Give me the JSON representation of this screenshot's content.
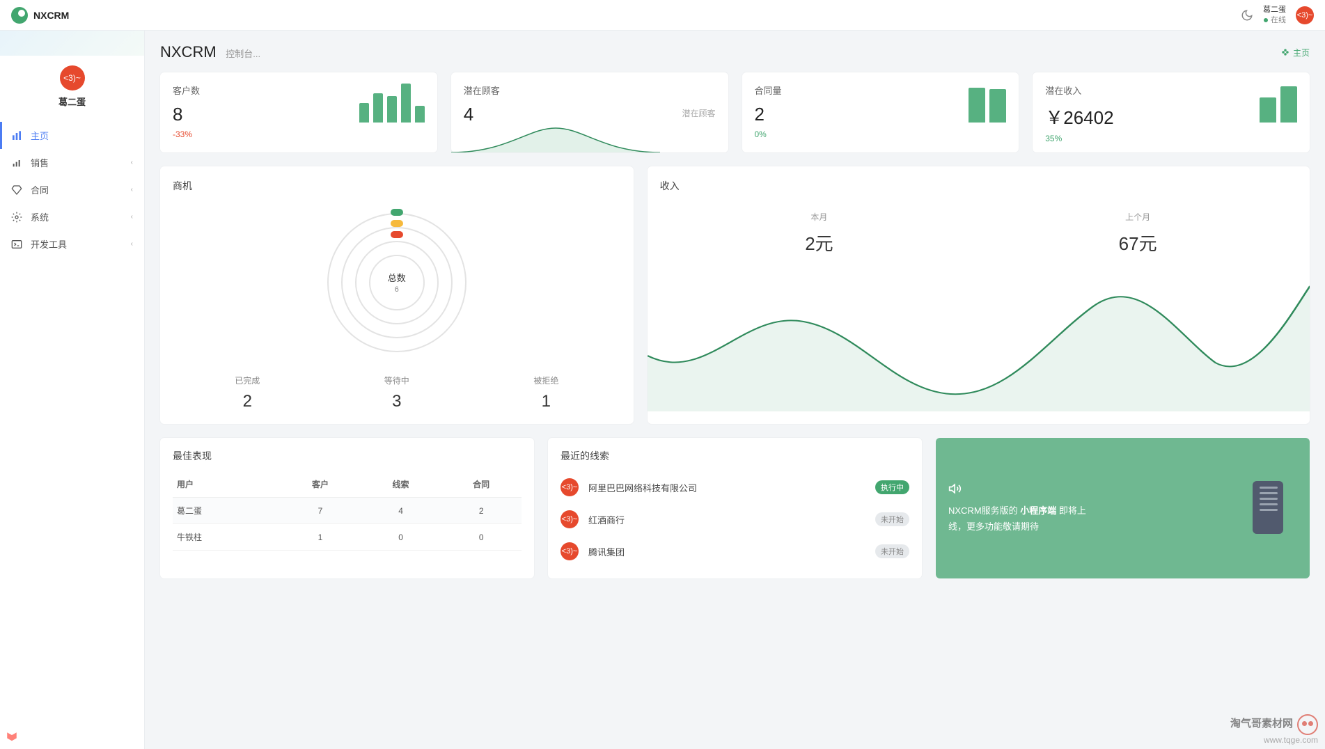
{
  "brand": "NXCRM",
  "header": {
    "user_name": "葛二蛋",
    "status_label": "在线",
    "avatar_text": "<3)~"
  },
  "sidebar": {
    "user_name": "葛二蛋",
    "avatar_text": "<3)~",
    "items": [
      {
        "label": "主页",
        "icon": "bars-icon",
        "active": true,
        "expand": false
      },
      {
        "label": "销售",
        "icon": "chart-icon",
        "active": false,
        "expand": true
      },
      {
        "label": "合同",
        "icon": "diamond-icon",
        "active": false,
        "expand": true
      },
      {
        "label": "系统",
        "icon": "gear-icon",
        "active": false,
        "expand": true
      },
      {
        "label": "开发工具",
        "icon": "terminal-icon",
        "active": false,
        "expand": true
      }
    ]
  },
  "page": {
    "title": "NXCRM",
    "subtitle": "控制台...",
    "breadcrumb_label": "主页"
  },
  "kpis": [
    {
      "label": "客户数",
      "value": "8",
      "change": "-33%",
      "change_dir": "neg",
      "spark": [
        28,
        42,
        38,
        56,
        24
      ]
    },
    {
      "label": "潜在顾客",
      "value": "4",
      "extra": "潜在顾客",
      "type": "area"
    },
    {
      "label": "合同量",
      "value": "2",
      "change": "0%",
      "change_dir": "pos",
      "spark": [
        50,
        48
      ],
      "wide": true
    },
    {
      "label": "潜在收入",
      "value": "￥26402",
      "change": "35%",
      "change_dir": "pos",
      "spark": [
        36,
        52
      ],
      "wide": true
    }
  ],
  "opportunity": {
    "title": "商机",
    "center_label": "总数",
    "center_value": "6",
    "stats": [
      {
        "label": "已完成",
        "value": "2"
      },
      {
        "label": "等待中",
        "value": "3"
      },
      {
        "label": "被拒绝",
        "value": "1"
      }
    ]
  },
  "revenue": {
    "title": "收入",
    "cols": [
      {
        "label": "本月",
        "value": "2元"
      },
      {
        "label": "上个月",
        "value": "67元"
      }
    ]
  },
  "best_table": {
    "title": "最佳表现",
    "headers": [
      "用户",
      "客户",
      "线索",
      "合同"
    ],
    "rows": [
      {
        "cells": [
          "葛二蛋",
          "7",
          "4",
          "2"
        ],
        "shade": true
      },
      {
        "cells": [
          "牛铁柱",
          "1",
          "0",
          "0"
        ],
        "shade": false
      }
    ]
  },
  "leads": {
    "title": "最近的线索",
    "items": [
      {
        "name": "阿里巴巴网络科技有限公司",
        "status": "执行中",
        "status_type": "green"
      },
      {
        "name": "红酒商行",
        "status": "未开始",
        "status_type": "gray"
      },
      {
        "name": "腾讯集团",
        "status": "未开始",
        "status_type": "gray"
      }
    ],
    "avatar_text": "<3)~"
  },
  "promo": {
    "line1_prefix": "NXCRM服务版的 ",
    "line1_strong": "小程序端",
    "line1_suffix": " 即将上线，更多功能敬请期待"
  },
  "chart_data": [
    {
      "type": "bar",
      "title": "客户数 spark",
      "values": [
        28,
        42,
        38,
        56,
        24
      ],
      "ylim": [
        0,
        60
      ]
    },
    {
      "type": "area",
      "title": "潜在顾客 spark",
      "x": [
        0,
        1,
        2,
        3,
        4,
        5,
        6
      ],
      "values": [
        0,
        0,
        12,
        34,
        12,
        0,
        0
      ]
    },
    {
      "type": "bar",
      "title": "合同量 spark",
      "values": [
        50,
        48
      ],
      "ylim": [
        0,
        60
      ]
    },
    {
      "type": "bar",
      "title": "潜在收入 spark",
      "values": [
        36,
        52
      ],
      "ylim": [
        0,
        60
      ]
    },
    {
      "type": "pie",
      "title": "商机",
      "series": [
        {
          "name": "已完成",
          "value": 2
        },
        {
          "name": "等待中",
          "value": 3
        },
        {
          "name": "被拒绝",
          "value": 1
        }
      ],
      "total": 6
    },
    {
      "type": "area",
      "title": "收入 trend",
      "x": [
        0,
        1,
        2,
        3,
        4,
        5,
        6,
        7,
        8,
        9,
        10,
        11
      ],
      "values": [
        40,
        20,
        55,
        50,
        30,
        10,
        45,
        80,
        60,
        30,
        50,
        90
      ]
    }
  ],
  "watermark": {
    "title": "淘气哥素材网",
    "sub": "www.tqge.com"
  }
}
